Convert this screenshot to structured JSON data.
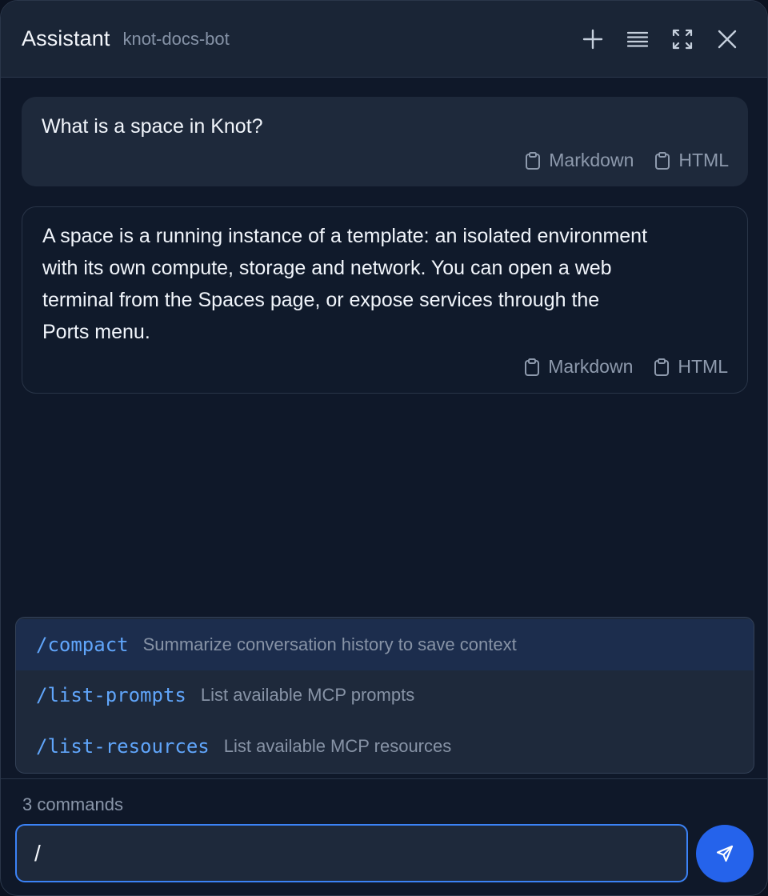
{
  "header": {
    "title": "Assistant",
    "subtitle": "knot-docs-bot",
    "actions": [
      "plus-icon",
      "list-icon",
      "fullscreen-icon",
      "close-icon"
    ]
  },
  "messages": [
    {
      "role": "user",
      "text": "What is a space in Knot?",
      "copy_markdown": "Markdown",
      "copy_html": "HTML"
    },
    {
      "role": "assistant",
      "text_lines": [
        "A space is a running instance of a template: an isolated environment",
        "with its own compute, storage and network. You can open a web",
        "terminal from the Spaces page, or expose services through the",
        "Ports menu."
      ],
      "copy_markdown": "Markdown",
      "copy_html": "HTML"
    }
  ],
  "commands": [
    {
      "name": "/compact",
      "description": "Summarize conversation history to save context",
      "active": true
    },
    {
      "name": "/list-prompts",
      "description": "List available MCP prompts",
      "active": false
    },
    {
      "name": "/list-resources",
      "description": "List available MCP resources",
      "active": false
    }
  ],
  "command_count": "3 commands",
  "input": {
    "value": "/"
  },
  "colors": {
    "accent": "#3b82f6",
    "send": "#2563eb",
    "command": "#60a5fa"
  }
}
